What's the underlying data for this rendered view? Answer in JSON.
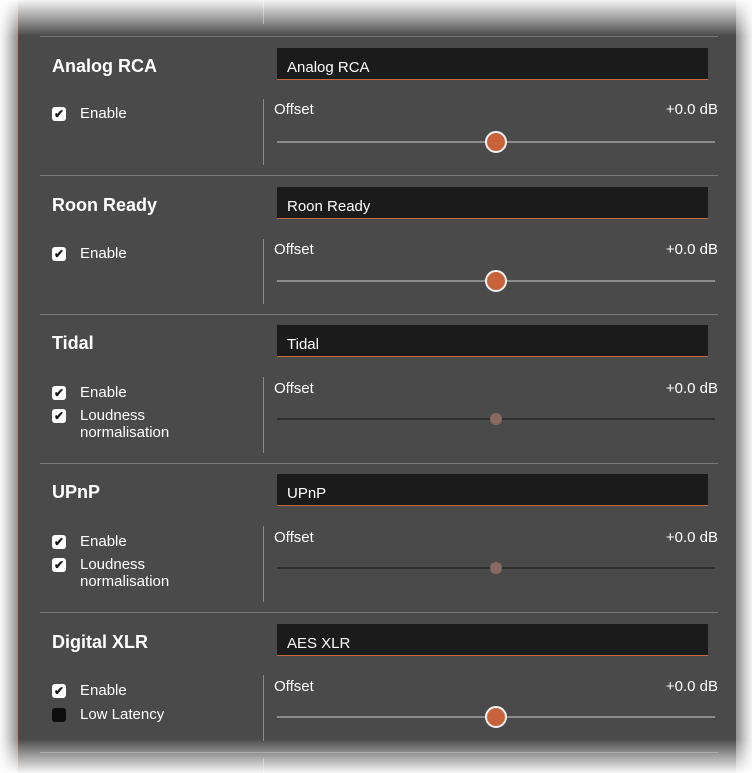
{
  "sections": [
    {
      "title": "Analog RCA",
      "name_value": "Analog RCA",
      "checks": [
        {
          "label": "Enable",
          "checked": true
        }
      ],
      "offset_label": "Offset",
      "offset_value": "+0.0 dB",
      "slider_enabled": true
    },
    {
      "title": "Roon Ready",
      "name_value": "Roon Ready",
      "checks": [
        {
          "label": "Enable",
          "checked": true
        }
      ],
      "offset_label": "Offset",
      "offset_value": "+0.0 dB",
      "slider_enabled": true
    },
    {
      "title": "Tidal",
      "name_value": "Tidal",
      "checks": [
        {
          "label": "Enable",
          "checked": true
        },
        {
          "label": "Loudness normalisation",
          "checked": true
        }
      ],
      "offset_label": "Offset",
      "offset_value": "+0.0 dB",
      "slider_enabled": false
    },
    {
      "title": "UPnP",
      "name_value": "UPnP",
      "checks": [
        {
          "label": "Enable",
          "checked": true
        },
        {
          "label": "Loudness normalisation",
          "checked": true
        }
      ],
      "offset_label": "Offset",
      "offset_value": "+0.0 dB",
      "slider_enabled": false
    },
    {
      "title": "Digital XLR",
      "name_value": "AES XLR",
      "checks": [
        {
          "label": "Enable",
          "checked": true
        },
        {
          "label": "Low Latency",
          "checked": false
        }
      ],
      "offset_label": "Offset",
      "offset_value": "+0.0 dB",
      "slider_enabled": true
    }
  ],
  "colors": {
    "panel_bg": "#4a4a4a",
    "input_bg": "#1b1b1b",
    "accent": "#c8623b"
  },
  "icons": {
    "checked": "✔"
  }
}
